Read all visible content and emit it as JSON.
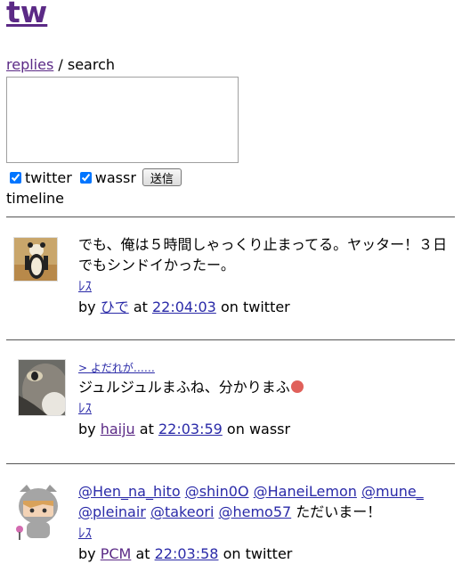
{
  "app": {
    "title": "tw"
  },
  "nav": {
    "replies": "replies",
    "separator": "/",
    "search": "search"
  },
  "form": {
    "status_value": "",
    "services": [
      {
        "label": "twitter",
        "checked": true
      },
      {
        "label": "wassr",
        "checked": true
      }
    ],
    "submit_label": "送信"
  },
  "timeline": {
    "label": "timeline",
    "entries": [
      {
        "reply_to": "",
        "text": "でも、俺は５時間しゃっくり止まってる。ヤッター！３日でもシンドイかったー。",
        "res": "ﾚｽ",
        "by": "by",
        "user": "ひで",
        "at": "at",
        "time": "22:04:03",
        "on": "on",
        "service": "twitter"
      },
      {
        "reply_to": "> よだれが……",
        "text": "ジュルジュルまふね、分かりまふ",
        "res": "ﾚｽ",
        "by": "by",
        "user": "haiju",
        "at": "at",
        "time": "22:03:59",
        "on": "on",
        "service": "wassr"
      },
      {
        "reply_to": "",
        "mentions": [
          "@Hen_na_hito",
          "@shin0O",
          "@HaneiLemon",
          "@mune_",
          "@pleinair",
          "@takeori",
          "@hemo57"
        ],
        "text": "ただいまー！",
        "res": "ﾚｽ",
        "by": "by",
        "user": "PCM",
        "at": "at",
        "time": "22:03:58",
        "on": "on",
        "service": "twitter"
      }
    ]
  },
  "colors": {
    "link": "#2a2aa8",
    "visited": "#5b2a86",
    "separator": "#555555"
  }
}
